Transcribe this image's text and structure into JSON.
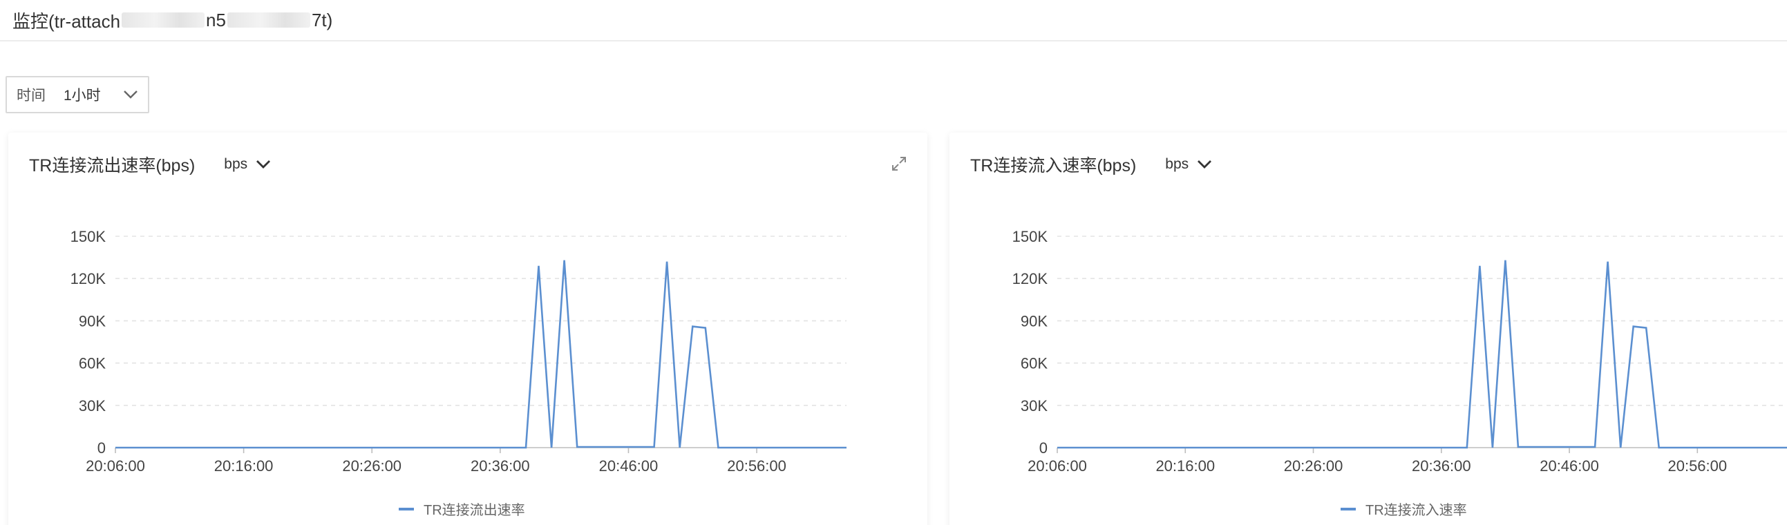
{
  "header": {
    "title_prefix": "监控(tr-attach",
    "title_mid": "n5",
    "title_suffix": "7t)"
  },
  "toolbar": {
    "time_label": "时间",
    "time_value": "1小时"
  },
  "colors": {
    "series": "#5b8fd0",
    "grid": "#e3e3e3"
  },
  "icons": {
    "dropdown": "chevron-down-icon",
    "expand": "expand-icon"
  },
  "charts": [
    {
      "title": "TR连接流出速率(bps)",
      "unit": "bps",
      "legend": "TR连接流出速率"
    },
    {
      "title": "TR连接流入速率(bps)",
      "unit": "bps",
      "legend": "TR连接流入速率"
    }
  ],
  "chart_data": [
    {
      "type": "line",
      "title": "TR连接流出速率(bps)",
      "ylabel": "bps",
      "ylim": [
        0,
        150000
      ],
      "yticks": [
        "0",
        "30K",
        "60K",
        "90K",
        "120K",
        "150K"
      ],
      "xticks": [
        "20:06:00",
        "20:16:00",
        "20:26:00",
        "20:36:00",
        "20:46:00",
        "20:56:00"
      ],
      "x_minutes_since_first_tick": [
        0,
        32,
        33,
        34,
        35,
        36,
        42,
        43,
        44,
        45,
        46,
        47,
        57
      ],
      "series": [
        {
          "name": "TR连接流出速率",
          "values": [
            0,
            0,
            129000,
            0,
            133000,
            500,
            500,
            132000,
            0,
            86000,
            85000,
            0,
            0
          ]
        }
      ],
      "grid": true,
      "legend_position": "bottom"
    },
    {
      "type": "line",
      "title": "TR连接流入速率(bps)",
      "ylabel": "bps",
      "ylim": [
        0,
        150000
      ],
      "yticks": [
        "0",
        "30K",
        "60K",
        "90K",
        "120K",
        "150K"
      ],
      "xticks": [
        "20:06:00",
        "20:16:00",
        "20:26:00",
        "20:36:00",
        "20:46:00",
        "20:56:00"
      ],
      "x_minutes_since_first_tick": [
        0,
        32,
        33,
        34,
        35,
        36,
        42,
        43,
        44,
        45,
        46,
        47,
        57
      ],
      "series": [
        {
          "name": "TR连接流入速率",
          "values": [
            0,
            0,
            129000,
            0,
            133000,
            500,
            500,
            132000,
            0,
            86000,
            85000,
            0,
            0
          ]
        }
      ],
      "grid": true,
      "legend_position": "bottom"
    }
  ]
}
